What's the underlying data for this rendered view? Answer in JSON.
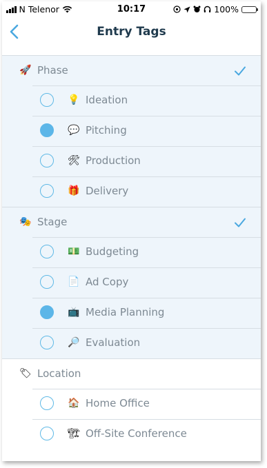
{
  "status": {
    "carrier": "N Telenor",
    "time": "10:17",
    "battery_pct": "100%",
    "battery_color": "#3bd14c"
  },
  "nav": {
    "title": "Entry Tags",
    "back_icon": "chevron-left-icon",
    "accent": "#4aa8e0"
  },
  "groups": [
    {
      "label": "Phase",
      "emoji": "🚀",
      "checked": true,
      "items": [
        {
          "label": "Ideation",
          "emoji": "💡",
          "selected": false
        },
        {
          "label": "Pitching",
          "emoji": "💬",
          "selected": true
        },
        {
          "label": "Production",
          "emoji": "🛠",
          "selected": false
        },
        {
          "label": "Delivery",
          "emoji": "🎁",
          "selected": false
        }
      ]
    },
    {
      "label": "Stage",
      "emoji": "🎭",
      "checked": true,
      "items": [
        {
          "label": "Budgeting",
          "emoji": "💵",
          "selected": false
        },
        {
          "label": "Ad Copy",
          "emoji": "📄",
          "selected": false
        },
        {
          "label": "Media Planning",
          "emoji": "📺",
          "selected": true
        },
        {
          "label": "Evaluation",
          "emoji": "🔎",
          "selected": false
        }
      ]
    },
    {
      "label": "Location",
      "emoji": "🏷",
      "checked": false,
      "items": [
        {
          "label": "Home Office",
          "emoji": "🏠",
          "selected": false
        },
        {
          "label": "Off-Site Conference",
          "emoji": "🏗",
          "selected": false
        }
      ]
    }
  ]
}
